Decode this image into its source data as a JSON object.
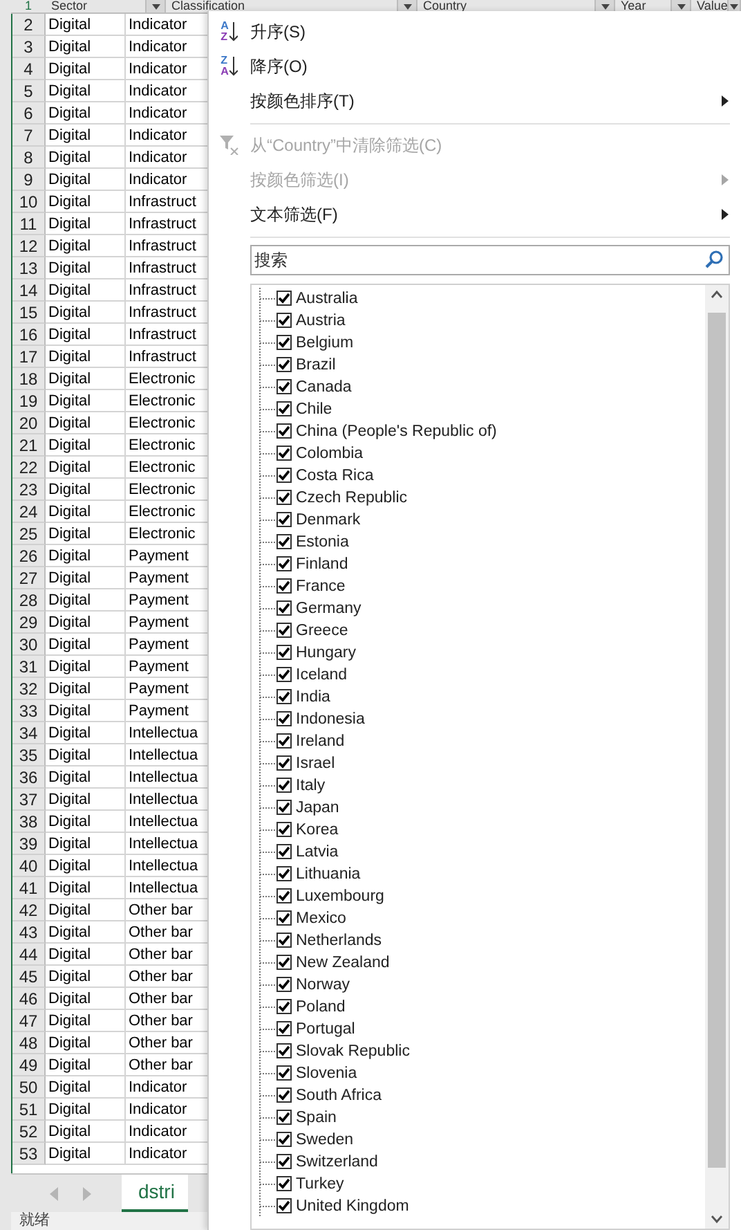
{
  "sheet": {
    "header": {
      "row_number": "1",
      "columns": [
        "Sector",
        "Classification",
        "Country",
        "Year",
        "Value"
      ]
    },
    "rows": [
      {
        "n": "2",
        "sector": "Digital",
        "classification": "Indicator"
      },
      {
        "n": "3",
        "sector": "Digital",
        "classification": "Indicator"
      },
      {
        "n": "4",
        "sector": "Digital",
        "classification": "Indicator"
      },
      {
        "n": "5",
        "sector": "Digital",
        "classification": "Indicator"
      },
      {
        "n": "6",
        "sector": "Digital",
        "classification": "Indicator"
      },
      {
        "n": "7",
        "sector": "Digital",
        "classification": "Indicator"
      },
      {
        "n": "8",
        "sector": "Digital",
        "classification": "Indicator"
      },
      {
        "n": "9",
        "sector": "Digital",
        "classification": "Indicator"
      },
      {
        "n": "10",
        "sector": "Digital",
        "classification": "Infrastruct"
      },
      {
        "n": "11",
        "sector": "Digital",
        "classification": "Infrastruct"
      },
      {
        "n": "12",
        "sector": "Digital",
        "classification": "Infrastruct"
      },
      {
        "n": "13",
        "sector": "Digital",
        "classification": "Infrastruct"
      },
      {
        "n": "14",
        "sector": "Digital",
        "classification": "Infrastruct"
      },
      {
        "n": "15",
        "sector": "Digital",
        "classification": "Infrastruct"
      },
      {
        "n": "16",
        "sector": "Digital",
        "classification": "Infrastruct"
      },
      {
        "n": "17",
        "sector": "Digital",
        "classification": "Infrastruct"
      },
      {
        "n": "18",
        "sector": "Digital",
        "classification": "Electronic"
      },
      {
        "n": "19",
        "sector": "Digital",
        "classification": "Electronic"
      },
      {
        "n": "20",
        "sector": "Digital",
        "classification": "Electronic"
      },
      {
        "n": "21",
        "sector": "Digital",
        "classification": "Electronic"
      },
      {
        "n": "22",
        "sector": "Digital",
        "classification": "Electronic"
      },
      {
        "n": "23",
        "sector": "Digital",
        "classification": "Electronic"
      },
      {
        "n": "24",
        "sector": "Digital",
        "classification": "Electronic"
      },
      {
        "n": "25",
        "sector": "Digital",
        "classification": "Electronic"
      },
      {
        "n": "26",
        "sector": "Digital",
        "classification": "Payment"
      },
      {
        "n": "27",
        "sector": "Digital",
        "classification": "Payment"
      },
      {
        "n": "28",
        "sector": "Digital",
        "classification": "Payment"
      },
      {
        "n": "29",
        "sector": "Digital",
        "classification": "Payment"
      },
      {
        "n": "30",
        "sector": "Digital",
        "classification": "Payment"
      },
      {
        "n": "31",
        "sector": "Digital",
        "classification": "Payment"
      },
      {
        "n": "32",
        "sector": "Digital",
        "classification": "Payment"
      },
      {
        "n": "33",
        "sector": "Digital",
        "classification": "Payment"
      },
      {
        "n": "34",
        "sector": "Digital",
        "classification": "Intellectua"
      },
      {
        "n": "35",
        "sector": "Digital",
        "classification": "Intellectua"
      },
      {
        "n": "36",
        "sector": "Digital",
        "classification": "Intellectua"
      },
      {
        "n": "37",
        "sector": "Digital",
        "classification": "Intellectua"
      },
      {
        "n": "38",
        "sector": "Digital",
        "classification": "Intellectua"
      },
      {
        "n": "39",
        "sector": "Digital",
        "classification": "Intellectua"
      },
      {
        "n": "40",
        "sector": "Digital",
        "classification": "Intellectua"
      },
      {
        "n": "41",
        "sector": "Digital",
        "classification": "Intellectua"
      },
      {
        "n": "42",
        "sector": "Digital",
        "classification": "Other bar"
      },
      {
        "n": "43",
        "sector": "Digital",
        "classification": "Other bar"
      },
      {
        "n": "44",
        "sector": "Digital",
        "classification": "Other bar"
      },
      {
        "n": "45",
        "sector": "Digital",
        "classification": "Other bar"
      },
      {
        "n": "46",
        "sector": "Digital",
        "classification": "Other bar"
      },
      {
        "n": "47",
        "sector": "Digital",
        "classification": "Other bar"
      },
      {
        "n": "48",
        "sector": "Digital",
        "classification": "Other bar"
      },
      {
        "n": "49",
        "sector": "Digital",
        "classification": "Other bar"
      },
      {
        "n": "50",
        "sector": "Digital",
        "classification": "Indicator"
      },
      {
        "n": "51",
        "sector": "Digital",
        "classification": "Indicator"
      },
      {
        "n": "52",
        "sector": "Digital",
        "classification": "Indicator"
      },
      {
        "n": "53",
        "sector": "Digital",
        "classification": "Indicator"
      }
    ],
    "sheet_tab": "dstri",
    "status": "就绪"
  },
  "menu": {
    "items": [
      {
        "kind": "sort",
        "icon_letters": [
          "A",
          "Z"
        ],
        "label": "升序(S)",
        "disabled": false
      },
      {
        "kind": "sort",
        "icon_letters": [
          "Z",
          "A"
        ],
        "label": "降序(O)",
        "disabled": false
      },
      {
        "kind": "submenu",
        "label": "按颜色排序(T)",
        "disabled": false
      },
      {
        "kind": "separator"
      },
      {
        "kind": "clear",
        "label": "从“Country”中清除筛选(C)",
        "disabled": true
      },
      {
        "kind": "submenu",
        "label": "按颜色筛选(I)",
        "disabled": true
      },
      {
        "kind": "submenu",
        "label": "文本筛选(F)",
        "disabled": false
      },
      {
        "kind": "separator"
      }
    ],
    "search": {
      "placeholder": "搜索"
    },
    "values": [
      {
        "label": "Australia",
        "checked": true
      },
      {
        "label": "Austria",
        "checked": true
      },
      {
        "label": "Belgium",
        "checked": true
      },
      {
        "label": "Brazil",
        "checked": true
      },
      {
        "label": "Canada",
        "checked": true
      },
      {
        "label": "Chile",
        "checked": true
      },
      {
        "label": "China (People's Republic of)",
        "checked": true
      },
      {
        "label": "Colombia",
        "checked": true
      },
      {
        "label": "Costa Rica",
        "checked": true
      },
      {
        "label": "Czech Republic",
        "checked": true
      },
      {
        "label": "Denmark",
        "checked": true
      },
      {
        "label": "Estonia",
        "checked": true
      },
      {
        "label": "Finland",
        "checked": true
      },
      {
        "label": "France",
        "checked": true
      },
      {
        "label": "Germany",
        "checked": true
      },
      {
        "label": "Greece",
        "checked": true
      },
      {
        "label": "Hungary",
        "checked": true
      },
      {
        "label": "Iceland",
        "checked": true
      },
      {
        "label": "India",
        "checked": true
      },
      {
        "label": "Indonesia",
        "checked": true
      },
      {
        "label": "Ireland",
        "checked": true
      },
      {
        "label": "Israel",
        "checked": true
      },
      {
        "label": "Italy",
        "checked": true
      },
      {
        "label": "Japan",
        "checked": true
      },
      {
        "label": "Korea",
        "checked": true
      },
      {
        "label": "Latvia",
        "checked": true
      },
      {
        "label": "Lithuania",
        "checked": true
      },
      {
        "label": "Luxembourg",
        "checked": true
      },
      {
        "label": "Mexico",
        "checked": true
      },
      {
        "label": "Netherlands",
        "checked": true
      },
      {
        "label": "New Zealand",
        "checked": true
      },
      {
        "label": "Norway",
        "checked": true
      },
      {
        "label": "Poland",
        "checked": true
      },
      {
        "label": "Portugal",
        "checked": true
      },
      {
        "label": "Slovak Republic",
        "checked": true
      },
      {
        "label": "Slovenia",
        "checked": true
      },
      {
        "label": "South Africa",
        "checked": true
      },
      {
        "label": "Spain",
        "checked": true
      },
      {
        "label": "Sweden",
        "checked": true
      },
      {
        "label": "Switzerland",
        "checked": true
      },
      {
        "label": "Turkey",
        "checked": true
      },
      {
        "label": "United Kingdom",
        "checked": true
      }
    ]
  }
}
